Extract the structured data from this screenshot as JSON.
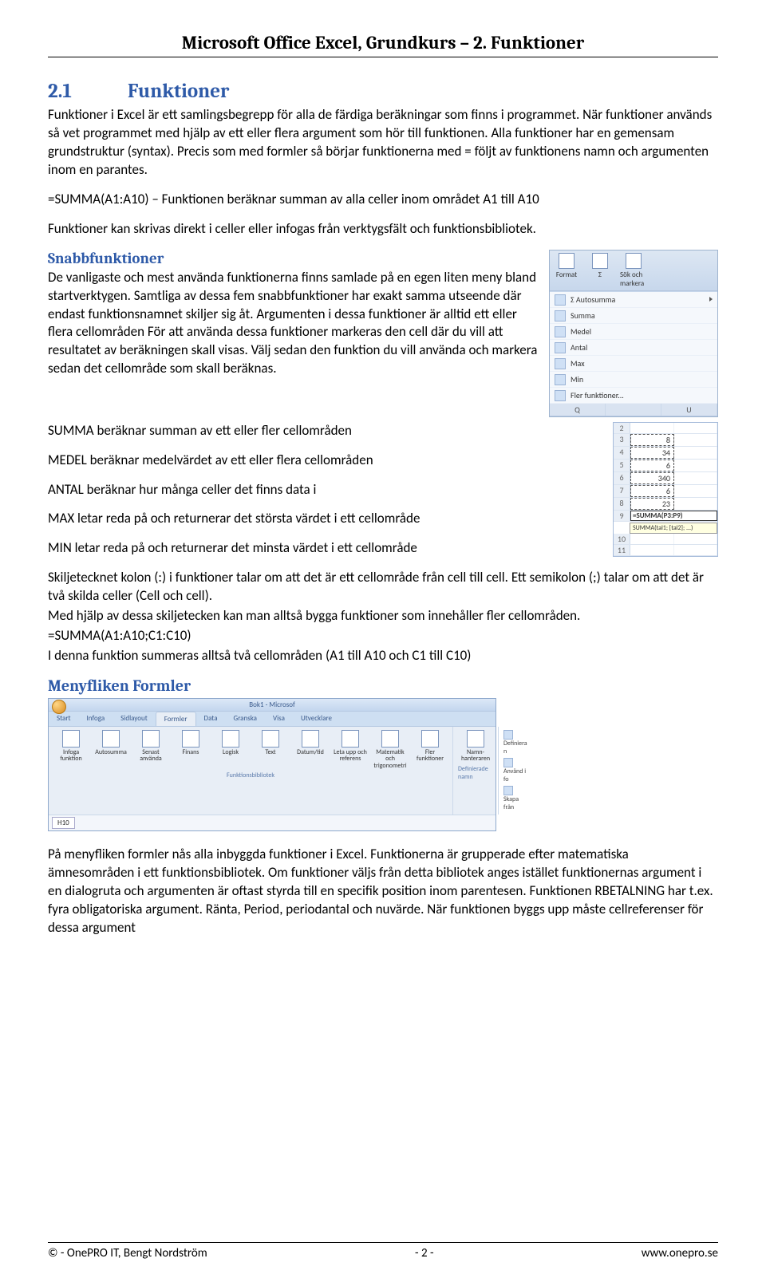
{
  "header": {
    "title": "Microsoft Office Excel, Grundkurs – 2. Funktioner"
  },
  "section": {
    "number": "2.1",
    "title": "Funktioner"
  },
  "intro": "Funktioner i Excel är ett samlingsbegrepp för alla de färdiga beräkningar som finns i programmet. När funktioner används så vet programmet med hjälp av ett eller flera argument som hör till funktionen. Alla funktioner har en gemensam grundstruktur (syntax). Precis som med formler så börjar funktionerna med = följt av funktionens namn och argumenten inom en parantes.",
  "example_line": "=SUMMA(A1:A10) – Funktionen beräknar summan av alla celler inom området A1 till A10",
  "after_example": "Funktioner kan skrivas direkt i celler eller infogas från verktygsfält och funktionsbibliotek.",
  "snabb": {
    "heading": "Snabbfunktioner",
    "text": "De vanligaste och mest använda funktionerna finns samlade på en egen liten meny bland startverktygen. Samtliga av dessa fem snabbfunktioner har exakt samma utseende där endast funktionsnamnet skiljer sig åt. Argumenten i dessa funktioner är alltid ett eller flera cellområden För att använda dessa funktioner markeras den cell där du vill att resultatet av beräkningen skall visas. Välj sedan den funktion du vill använda och markera sedan det cellområde som skall beräknas."
  },
  "func_lines": {
    "summa": "SUMMA beräknar summan av ett eller fler cellområden",
    "medel": "MEDEL beräknar medelvärdet av ett eller flera cellområden",
    "antal": "ANTAL beräknar hur många celler det finns data i",
    "max": "MAX letar reda på och returnerar det största värdet i ett cellområde",
    "min": "MIN letar reda på och returnerar det minsta värdet i ett cellområde"
  },
  "skilje": {
    "p1": "Skiljetecknet kolon (:) i funktioner talar om att det är ett cellområde från cell till cell. Ett semikolon (;) talar om att det är två skilda celler (Cell och cell).",
    "p2": "Med hjälp av dessa skiljetecken kan man alltså bygga funktioner som innehåller fler cellområden.",
    "formula": "=SUMMA(A1:A10;C1:C10)",
    "p3": "I denna funktion summeras alltså två cellområden (A1 till A10 och C1 till C10)"
  },
  "meny": {
    "heading": "Menyfliken Formler",
    "text": "På menyfliken formler nås alla inbyggda funktioner i Excel. Funktionerna är grupperade efter matematiska ämnesområden i ett funktionsbibliotek. Om funktioner väljs från detta bibliotek anges istället funktionernas argument i en dialogruta och argumenten är oftast styrda till en specifik position inom parentesen. Funktionen RBETALNING har t.ex. fyra obligatoriska argument. Ränta, Period, periodantal och nuvärde. När funktionen byggs upp måste cellreferenser för dessa argument"
  },
  "dropdown": {
    "autosumma_top": "Σ Autosumma",
    "items": [
      "Summa",
      "Medel",
      "Antal",
      "Max",
      "Min",
      "Fler funktioner..."
    ],
    "top_btns": [
      "Format",
      "Σ",
      "Sök och markera"
    ],
    "cols": [
      "Q",
      "",
      "U"
    ]
  },
  "cells": {
    "rows": [
      "2",
      "3",
      "4",
      "5",
      "6",
      "7"
    ],
    "values": [
      "8",
      "34",
      "6",
      "340",
      "6",
      "23"
    ],
    "formula_display": "=SUMMA(P3:P9)",
    "tooltip": "SUMMA(tal1; [tal2]; ...)"
  },
  "ribbon": {
    "title": "Bok1 - Microsof",
    "tabs": [
      "Start",
      "Infoga",
      "Sidlayout",
      "Formler",
      "Data",
      "Granska",
      "Visa",
      "Utvecklare"
    ],
    "active_tab": 3,
    "buttons": [
      "Infoga funktion",
      "Autosumma",
      "Senast använda",
      "Finans",
      "Logisk",
      "Text",
      "Datum/tid",
      "Leta upp och referens",
      "Matematik och trigonometri",
      "Fler funktioner"
    ],
    "group1_label": "Funktionsbibliotek",
    "side_items": [
      "Definiera n",
      "Använd i fo",
      "Skapa från"
    ],
    "group2_label": "Definierade namn",
    "name_mgr": "Namn-hanteraren",
    "namebox": "H10"
  },
  "footer": {
    "left": "© - OnePRO IT, Bengt Nordström",
    "center": "- 2 -",
    "right": "www.onepro.se"
  }
}
